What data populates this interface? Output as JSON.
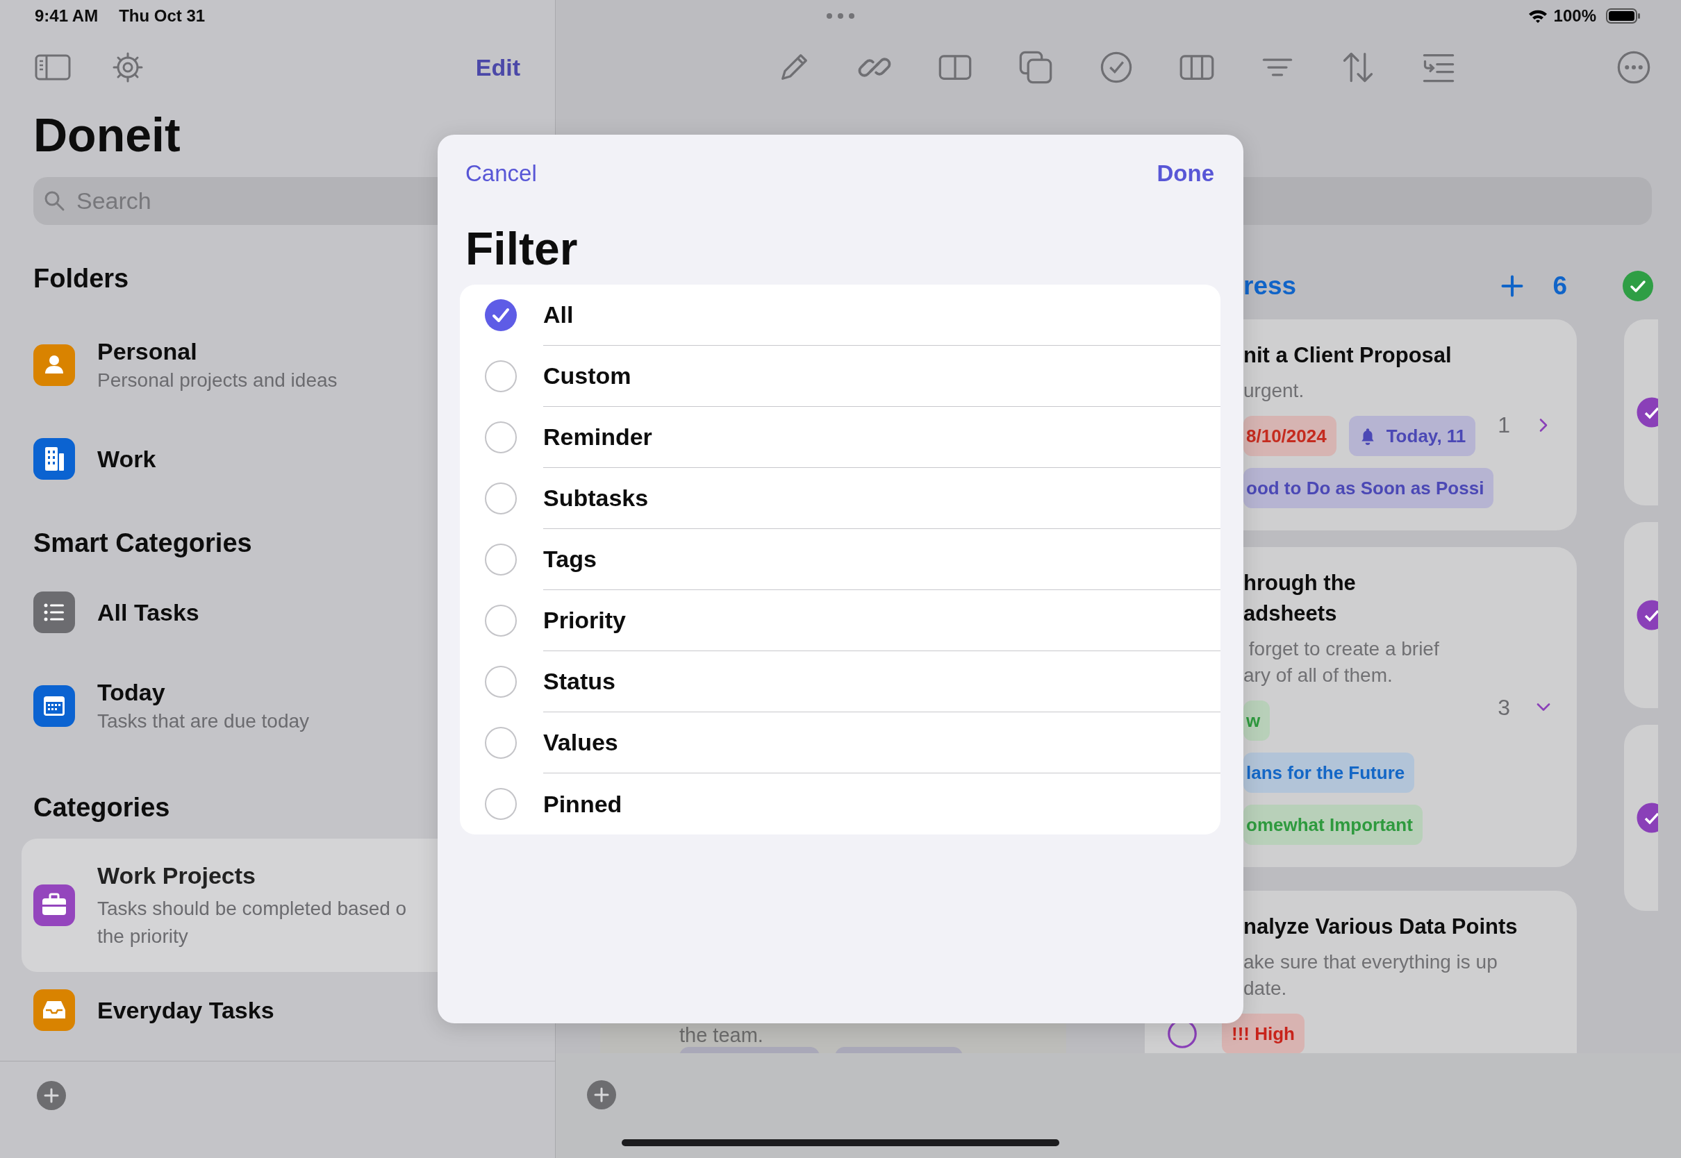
{
  "status_bar": {
    "time": "9:41 AM",
    "date": "Thu Oct 31",
    "battery": "100%"
  },
  "sidebar": {
    "edit": "Edit",
    "title": "Doneit",
    "search": {
      "placeholder": "Search"
    },
    "sections": [
      {
        "title": "Folders",
        "items": [
          {
            "title": "Personal",
            "subtitle": [
              "Personal projects and ideas"
            ],
            "color": "#d98300",
            "selected": false
          },
          {
            "title": "Work",
            "color": "#0b63d1",
            "selected": false
          }
        ]
      },
      {
        "title": "Smart Categories",
        "items": [
          {
            "title": "All Tasks",
            "color": "#6c6c70",
            "selected": false
          },
          {
            "title": "Today",
            "subtitle": [
              "Tasks that are due today"
            ],
            "color": "#0b63d1",
            "selected": false
          }
        ]
      },
      {
        "title": "Categories",
        "items": [
          {
            "title": "Work Projects",
            "subtitle": [
              "Tasks should be completed based o",
              "the priority"
            ],
            "color": "#9445bd",
            "selected": true
          },
          {
            "title": "Everyday Tasks",
            "color": "#d98300",
            "selected": false
          }
        ]
      }
    ]
  },
  "board": {
    "column_title": "ress",
    "count": "6",
    "hidden_card": {
      "text": "the team."
    },
    "cards": [
      {
        "title": [
          "nit a Client Proposal"
        ],
        "note": [
          "urgent."
        ],
        "count": "1",
        "expanded": false,
        "tag_rows": [
          [
            {
              "text": "8/10/2024",
              "kind": "date"
            },
            {
              "text": "Today, 11",
              "kind": "reminder"
            }
          ],
          [
            {
              "text": "ood to Do as Soon as Possi",
              "kind": "medium"
            }
          ]
        ]
      },
      {
        "title": [
          "hrough the",
          "adsheets"
        ],
        "note": [
          " forget to create a brief",
          "ary of all of them."
        ],
        "count": "3",
        "expanded": true,
        "tag_rows": [
          [
            {
              "text": "w",
              "kind": "status"
            }
          ],
          [
            {
              "text": "lans for the Future",
              "kind": "list"
            }
          ],
          [
            {
              "text": "omewhat Important",
              "kind": "low"
            }
          ]
        ]
      },
      {
        "title": [
          "nalyze Various Data Points"
        ],
        "note": [
          "ake sure that everything is up",
          "date."
        ],
        "checked": false,
        "tag_rows": [
          [
            {
              "text": "!!! High",
              "kind": "high"
            }
          ]
        ]
      }
    ],
    "next_column": [
      {
        "checked": true
      },
      {
        "checked": true
      },
      {
        "checked": true
      }
    ]
  },
  "filter": {
    "cancel": "Cancel",
    "done": "Done",
    "title": "Filter",
    "options": [
      {
        "label": "All",
        "selected": true
      },
      {
        "label": "Custom",
        "selected": false
      },
      {
        "label": "Reminder",
        "selected": false
      },
      {
        "label": "Subtasks",
        "selected": false
      },
      {
        "label": "Tags",
        "selected": false
      },
      {
        "label": "Priority",
        "selected": false
      },
      {
        "label": "Status",
        "selected": false
      },
      {
        "label": "Values",
        "selected": false
      },
      {
        "label": "Pinned",
        "selected": false
      }
    ]
  }
}
